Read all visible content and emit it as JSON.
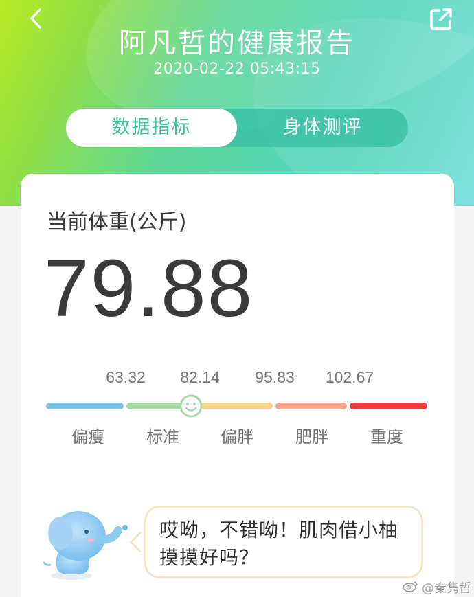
{
  "header": {
    "title": "阿凡哲的健康报告",
    "timestamp": "2020-02-22 05:43:15",
    "tabs": [
      {
        "label": "数据指标",
        "active": true
      },
      {
        "label": "身体测评",
        "active": false
      }
    ]
  },
  "weight": {
    "label": "当前体重(公斤)",
    "value": "79.88"
  },
  "scale": {
    "thresholds": [
      "63.32",
      "82.14",
      "95.83",
      "102.67"
    ],
    "categories": [
      {
        "label": "偏瘦",
        "color": "#7fc4e4"
      },
      {
        "label": "标准",
        "color": "#a8d9a4"
      },
      {
        "label": "偏胖",
        "color": "#f5d489"
      },
      {
        "label": "肥胖",
        "color": "#f6a68a"
      },
      {
        "label": "重度",
        "color": "#ec3b3e"
      }
    ],
    "current_category": "标准"
  },
  "message": {
    "text": "哎呦，不错呦！肌肉借小柚摸摸好吗？"
  },
  "watermark": "@秦隽哲",
  "icons": {
    "back": "chevron-left-icon",
    "share": "share-icon",
    "smiley": "smiley-icon",
    "mascot": "elephant-mascot",
    "weibo": "weibo-icon"
  },
  "colors": {
    "accent": "#38c29e",
    "text_dark": "#3a3a3a",
    "bubble_border": "#f2e7c4"
  }
}
